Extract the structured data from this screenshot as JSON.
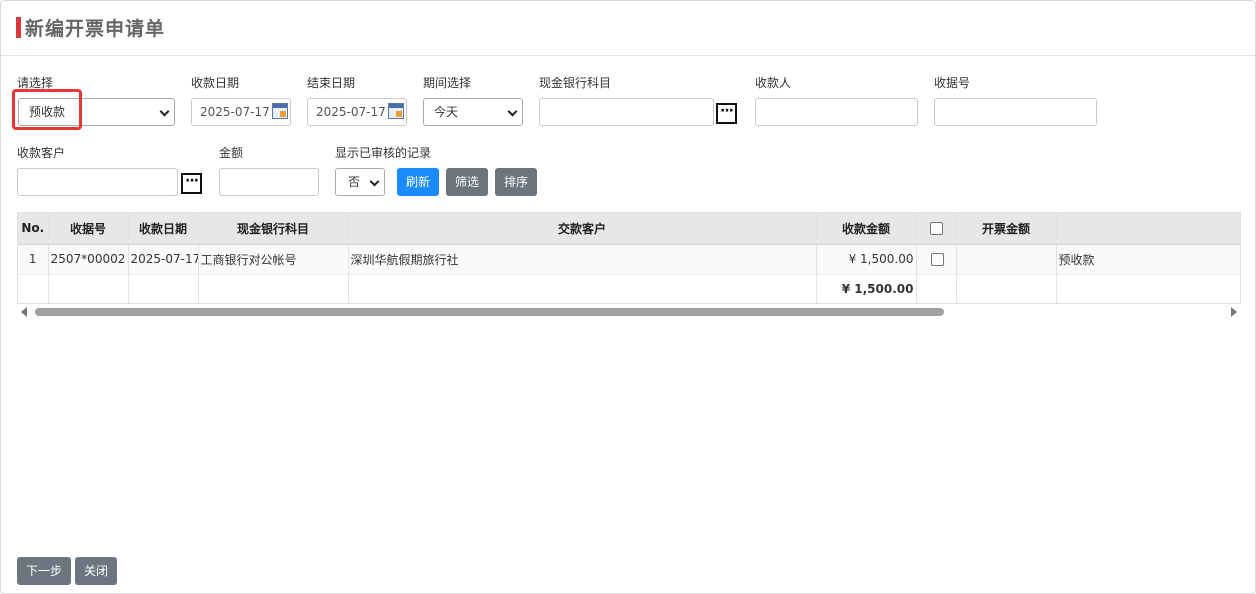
{
  "dialog": {
    "title": "新编开票申请单"
  },
  "filters": {
    "choose": {
      "label": "请选择",
      "value": "预收款"
    },
    "receipt_date": {
      "label": "收款日期",
      "value": "2025-07-17"
    },
    "end_date": {
      "label": "结束日期",
      "value": "2025-07-17"
    },
    "period": {
      "label": "期间选择",
      "value": "今天"
    },
    "cash_account": {
      "label": "现金银行科目",
      "value": ""
    },
    "payee": {
      "label": "收款人",
      "value": ""
    },
    "receipt_no": {
      "label": "收据号",
      "value": ""
    },
    "customer": {
      "label": "收款客户",
      "value": ""
    },
    "amount": {
      "label": "金额",
      "value": ""
    },
    "show_audited": {
      "label": "显示已审核的记录",
      "value": "否"
    }
  },
  "actions": {
    "refresh": "刷新",
    "filter": "筛选",
    "sort": "排序"
  },
  "table": {
    "columns": [
      "No.",
      "收据号",
      "收款日期",
      "现金银行科目",
      "交款客户",
      "收款金额",
      "",
      "开票金额",
      ""
    ],
    "rows": [
      {
        "no": "1",
        "receipt_no": "2507*00002",
        "date": "2025-07-17",
        "account": "工商银行对公帐号",
        "customer": "深圳华航假期旅行社",
        "amount": "¥ 1,500.00",
        "invoice_amount": "",
        "type": "预收款"
      }
    ],
    "total": {
      "amount": "¥ 1,500.00"
    }
  },
  "footer": {
    "next": "下一步",
    "close": "关闭"
  },
  "colors": {
    "accent_red": "#d9383a",
    "primary_blue": "#1a8cff",
    "button_gray": "#6c757d"
  },
  "icons": [
    "calendar-icon",
    "ellipsis-icon",
    "chevron-down-icon"
  ]
}
